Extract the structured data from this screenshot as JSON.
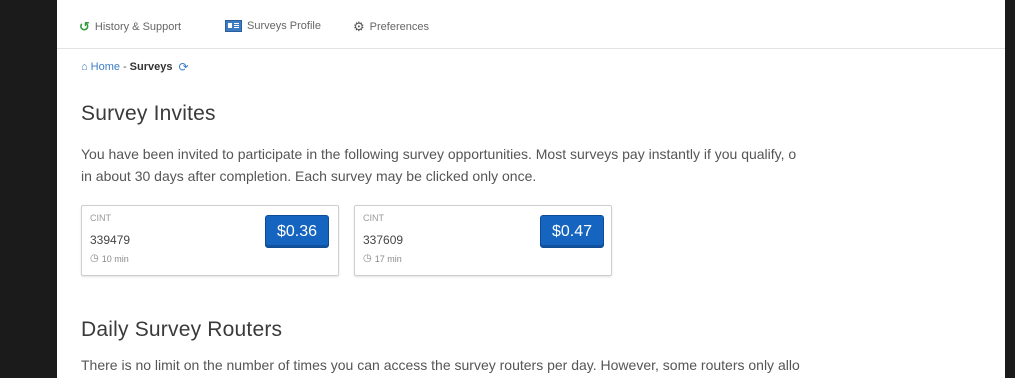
{
  "nav": {
    "items": [
      {
        "label": "History & Support",
        "icon": "history-icon"
      },
      {
        "label": "Surveys Profile",
        "icon": "profile-card-icon"
      },
      {
        "label": "Preferences",
        "icon": "gear-icon"
      }
    ]
  },
  "breadcrumb": {
    "home": "Home",
    "separator": "-",
    "current": "Surveys"
  },
  "invites": {
    "title": "Survey Invites",
    "description_line1": "You have been invited to participate in the following survey opportunities. Most surveys pay instantly if you qualify, o",
    "description_line2": "in about 30 days after completion. Each survey may be clicked only once.",
    "cards": [
      {
        "provider": "CINT",
        "id": "339479",
        "time": "10 min",
        "price": "$0.36"
      },
      {
        "provider": "CINT",
        "id": "337609",
        "time": "17 min",
        "price": "$0.47"
      }
    ]
  },
  "routers": {
    "title": "Daily Survey Routers",
    "description": "There is no limit on the number of times you can access the survey routers per day. However, some routers only allo"
  },
  "colors": {
    "accent": "#3c7cc4",
    "price_button": "#1565c0",
    "history_icon": "#2e9a3c",
    "frame": "#1b1b1b"
  }
}
